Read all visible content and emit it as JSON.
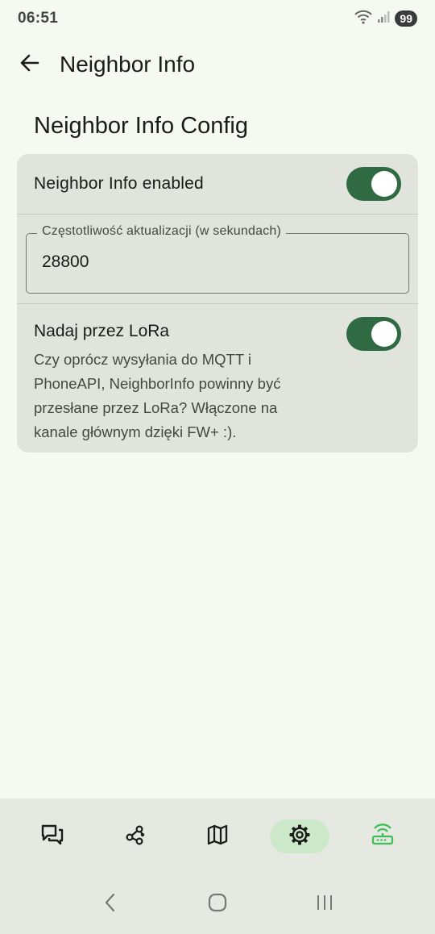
{
  "status_bar": {
    "time": "06:51",
    "battery": "99",
    "icons": [
      "wifi-icon",
      "signal-icon"
    ]
  },
  "top_bar": {
    "title": "Neighbor Info",
    "back_icon": "arrow-left-icon"
  },
  "section": {
    "title": "Neighbor Info Config"
  },
  "settings": {
    "enabled": {
      "label": "Neighbor Info enabled",
      "checked": true
    },
    "update_interval": {
      "label": "Częstotliwość aktualizacji (w sekundach)",
      "value": "28800"
    },
    "lora": {
      "title": "Nadaj przez LoRa",
      "description": "Czy oprócz wysyłania do MQTT i PhoneAPI, NeighborInfo powinny być przesłane przez LoRa? Włączone na kanale głównym dzięki FW+ :).",
      "checked": true
    }
  },
  "bottom_nav": {
    "items": [
      {
        "icon": "messages-icon",
        "active": false
      },
      {
        "icon": "nodes-icon",
        "active": false
      },
      {
        "icon": "map-icon",
        "active": false
      },
      {
        "icon": "settings-gear-icon",
        "active": true
      },
      {
        "icon": "router-icon",
        "active": false
      }
    ]
  },
  "colors": {
    "accent": "#2f6a43",
    "card": "#e1e4dc",
    "background": "#f6f8f2",
    "active_nav": "#cbe8c9",
    "router_icon": "#3fbf5a"
  }
}
